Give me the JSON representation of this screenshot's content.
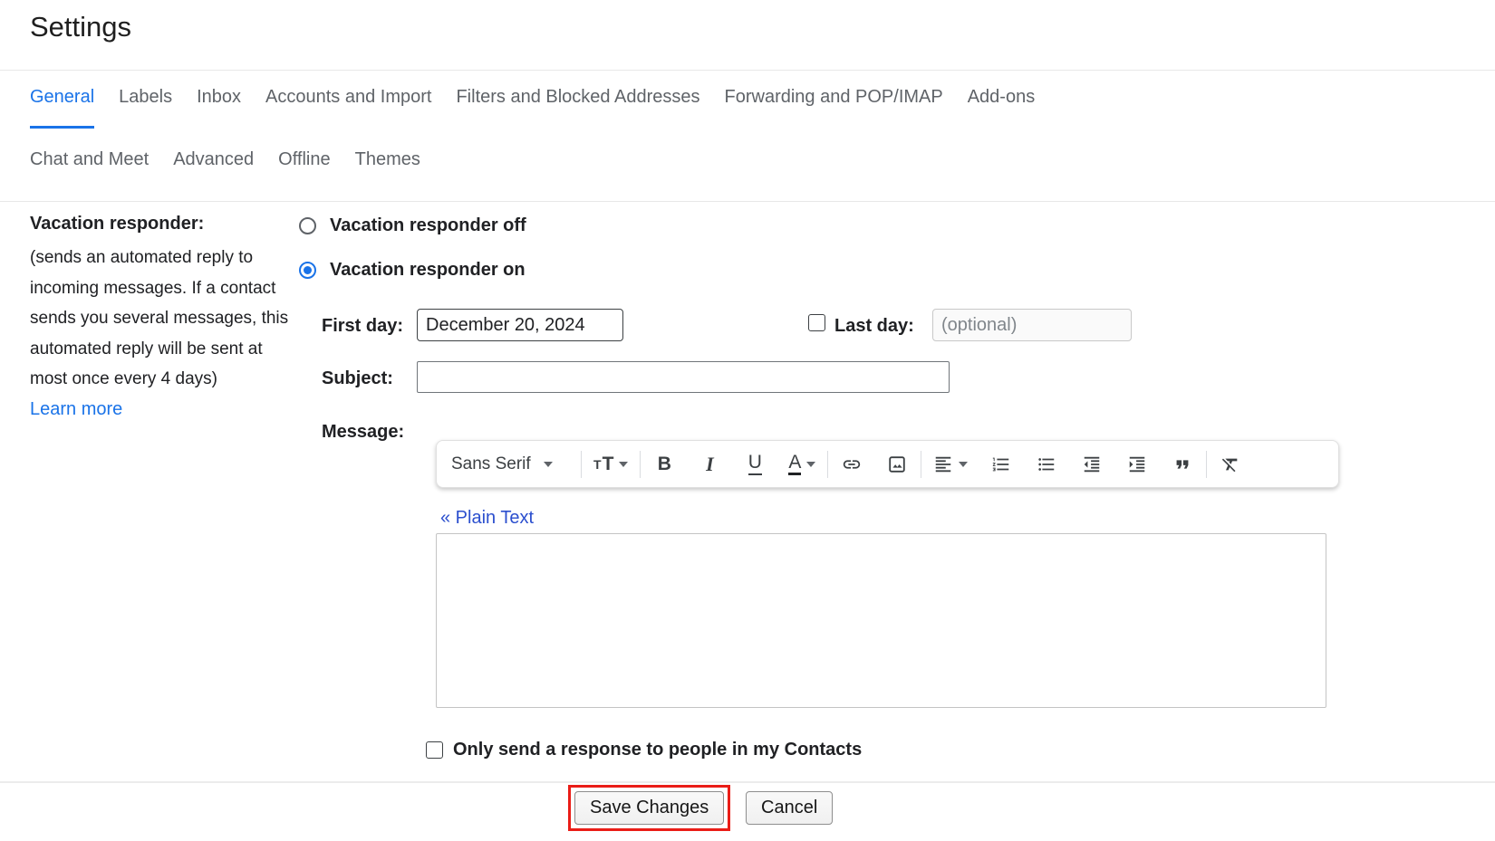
{
  "page": {
    "title": "Settings"
  },
  "tabs": {
    "row1": [
      {
        "label": "General",
        "active": true
      },
      {
        "label": "Labels",
        "active": false
      },
      {
        "label": "Inbox",
        "active": false
      },
      {
        "label": "Accounts and Import",
        "active": false
      },
      {
        "label": "Filters and Blocked Addresses",
        "active": false
      },
      {
        "label": "Forwarding and POP/IMAP",
        "active": false
      },
      {
        "label": "Add-ons",
        "active": false
      }
    ],
    "row2": [
      {
        "label": "Chat and Meet",
        "active": false
      },
      {
        "label": "Advanced",
        "active": false
      },
      {
        "label": "Offline",
        "active": false
      },
      {
        "label": "Themes",
        "active": false
      }
    ]
  },
  "vacation": {
    "section_label": "Vacation responder:",
    "description": "(sends an automated reply to incoming messages. If a contact sends you several messages, this automated reply will be sent at most once every 4 days)",
    "learn_more_label": "Learn more",
    "radio_off": {
      "label": "Vacation responder off",
      "selected": false
    },
    "radio_on": {
      "label": "Vacation responder on",
      "selected": true
    },
    "first_day": {
      "label": "First day:",
      "value": "December 20, 2024"
    },
    "last_day": {
      "label": "Last day:",
      "placeholder": "(optional)",
      "checked": false,
      "value": ""
    },
    "subject": {
      "label": "Subject:",
      "value": ""
    },
    "message": {
      "label": "Message:",
      "plain_text_link": "« Plain Text",
      "body": ""
    },
    "contacts_checkbox": {
      "label": "Only send a response to people in my Contacts",
      "checked": false
    }
  },
  "toolbar": {
    "font_name": "Sans Serif",
    "icon_glyphs": {
      "size_small": "T",
      "size_large": "T",
      "bold": "B",
      "italic": "I",
      "underline": "U",
      "text_color": "A"
    },
    "buttons": [
      "font-family-dropdown",
      "font-size-dropdown",
      "bold",
      "italic",
      "underline",
      "text-color-dropdown",
      "insert-link",
      "insert-image",
      "align-dropdown",
      "numbered-list",
      "bulleted-list",
      "indent-less",
      "indent-more",
      "quote",
      "remove-formatting"
    ]
  },
  "actions": {
    "save_label": "Save Changes",
    "cancel_label": "Cancel"
  },
  "colors": {
    "accent_blue": "#1a73e8",
    "link_blue": "#2b4fce",
    "tab_gray": "#5f6368",
    "highlight_red": "#ea1d17"
  }
}
